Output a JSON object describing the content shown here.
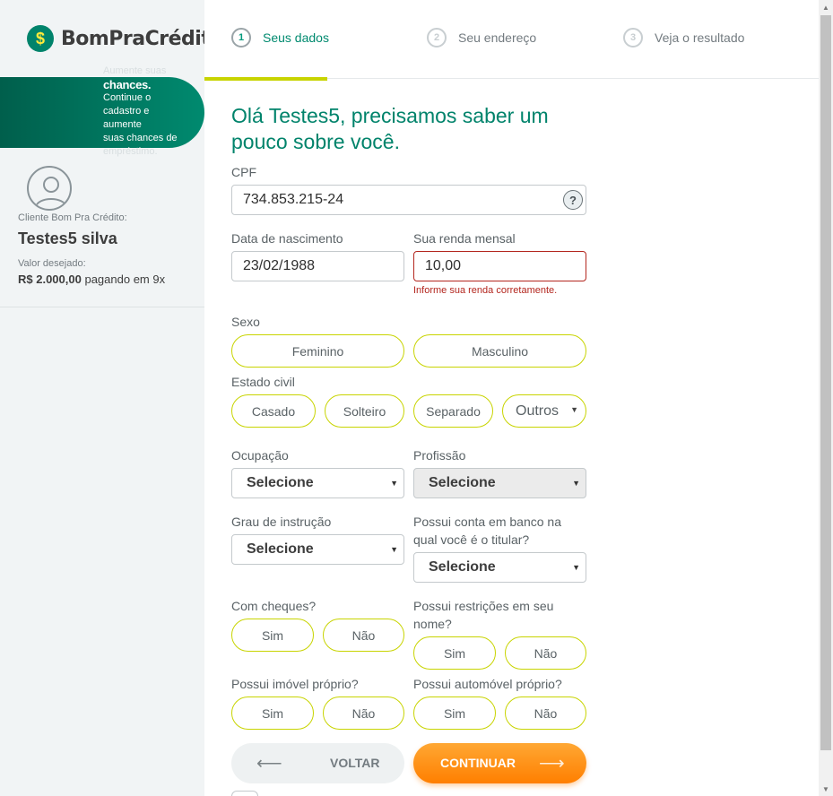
{
  "brand": {
    "logo_symbol": "$",
    "name": "BomPraCrédito",
    "primary_color": "#00836b",
    "accent_color": "#c8d400",
    "cta_color": "#ff8a00"
  },
  "banner": {
    "line1": "Aumente suas",
    "line2": "chances.",
    "line3": "Continue o",
    "line4": "cadastro e",
    "line5": "aumente",
    "line6": "suas chances de",
    "line7": "empréstimo."
  },
  "client": {
    "label": "Cliente Bom Pra Crédito:",
    "name": "Testes5 silva",
    "valor_label": "Valor desejado:",
    "valor_amount": "R$ 2.000,00",
    "valor_terms": "pagando em 9x"
  },
  "steps": [
    {
      "number": "1",
      "label": "Seus dados",
      "active": true
    },
    {
      "number": "2",
      "label": "Seu endereço",
      "active": false
    },
    {
      "number": "3",
      "label": "Veja o resultado",
      "active": false
    }
  ],
  "form": {
    "title": "Olá Testes5, precisamos saber um pouco sobre você.",
    "cpf": {
      "label": "CPF",
      "value": "734.853.215-24",
      "help": "?"
    },
    "nascimento": {
      "label": "Data de nascimento",
      "value": "23/02/1988"
    },
    "renda": {
      "label": "Sua renda mensal",
      "value": "10,00",
      "error": "Informe sua renda corretamente."
    },
    "sexo": {
      "label": "Sexo",
      "options": [
        "Feminino",
        "Masculino"
      ]
    },
    "estado_civil": {
      "label": "Estado civil",
      "options": [
        "Casado",
        "Solteiro",
        "Separado"
      ],
      "other": "Outros"
    },
    "ocupacao": {
      "label": "Ocupação",
      "value": "Selecione"
    },
    "profissao": {
      "label": "Profissão",
      "value": "Selecione"
    },
    "grau": {
      "label": "Grau de instrução",
      "value": "Selecione"
    },
    "conta": {
      "label_line1": "Possui conta em banco na",
      "label_line2": "qual você é o titular?",
      "value": "Selecione"
    },
    "cheques": {
      "label": "Com cheques?",
      "yes": "Sim",
      "no": "Não"
    },
    "restricoes": {
      "label_line1": "Possui restrições em seu",
      "label_line2": "nome?",
      "yes": "Sim",
      "no": "Não"
    },
    "imovel": {
      "label": "Possui imóvel próprio?",
      "yes": "Sim",
      "no": "Não"
    },
    "automovel": {
      "label": "Possui automóvel próprio?",
      "yes": "Sim",
      "no": "Não"
    }
  },
  "actions": {
    "back": "VOLTAR",
    "next": "CONTINUAR"
  }
}
